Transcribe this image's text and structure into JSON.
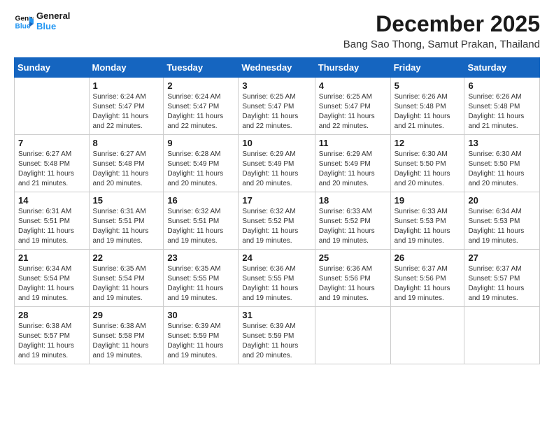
{
  "header": {
    "logo_line1": "General",
    "logo_line2": "Blue",
    "title": "December 2025",
    "subtitle": "Bang Sao Thong, Samut Prakan, Thailand"
  },
  "days_of_week": [
    "Sunday",
    "Monday",
    "Tuesday",
    "Wednesday",
    "Thursday",
    "Friday",
    "Saturday"
  ],
  "weeks": [
    [
      {
        "day": "",
        "info": ""
      },
      {
        "day": "1",
        "info": "Sunrise: 6:24 AM\nSunset: 5:47 PM\nDaylight: 11 hours\nand 22 minutes."
      },
      {
        "day": "2",
        "info": "Sunrise: 6:24 AM\nSunset: 5:47 PM\nDaylight: 11 hours\nand 22 minutes."
      },
      {
        "day": "3",
        "info": "Sunrise: 6:25 AM\nSunset: 5:47 PM\nDaylight: 11 hours\nand 22 minutes."
      },
      {
        "day": "4",
        "info": "Sunrise: 6:25 AM\nSunset: 5:47 PM\nDaylight: 11 hours\nand 22 minutes."
      },
      {
        "day": "5",
        "info": "Sunrise: 6:26 AM\nSunset: 5:48 PM\nDaylight: 11 hours\nand 21 minutes."
      },
      {
        "day": "6",
        "info": "Sunrise: 6:26 AM\nSunset: 5:48 PM\nDaylight: 11 hours\nand 21 minutes."
      }
    ],
    [
      {
        "day": "7",
        "info": "Sunrise: 6:27 AM\nSunset: 5:48 PM\nDaylight: 11 hours\nand 21 minutes."
      },
      {
        "day": "8",
        "info": "Sunrise: 6:27 AM\nSunset: 5:48 PM\nDaylight: 11 hours\nand 20 minutes."
      },
      {
        "day": "9",
        "info": "Sunrise: 6:28 AM\nSunset: 5:49 PM\nDaylight: 11 hours\nand 20 minutes."
      },
      {
        "day": "10",
        "info": "Sunrise: 6:29 AM\nSunset: 5:49 PM\nDaylight: 11 hours\nand 20 minutes."
      },
      {
        "day": "11",
        "info": "Sunrise: 6:29 AM\nSunset: 5:49 PM\nDaylight: 11 hours\nand 20 minutes."
      },
      {
        "day": "12",
        "info": "Sunrise: 6:30 AM\nSunset: 5:50 PM\nDaylight: 11 hours\nand 20 minutes."
      },
      {
        "day": "13",
        "info": "Sunrise: 6:30 AM\nSunset: 5:50 PM\nDaylight: 11 hours\nand 20 minutes."
      }
    ],
    [
      {
        "day": "14",
        "info": "Sunrise: 6:31 AM\nSunset: 5:51 PM\nDaylight: 11 hours\nand 19 minutes."
      },
      {
        "day": "15",
        "info": "Sunrise: 6:31 AM\nSunset: 5:51 PM\nDaylight: 11 hours\nand 19 minutes."
      },
      {
        "day": "16",
        "info": "Sunrise: 6:32 AM\nSunset: 5:51 PM\nDaylight: 11 hours\nand 19 minutes."
      },
      {
        "day": "17",
        "info": "Sunrise: 6:32 AM\nSunset: 5:52 PM\nDaylight: 11 hours\nand 19 minutes."
      },
      {
        "day": "18",
        "info": "Sunrise: 6:33 AM\nSunset: 5:52 PM\nDaylight: 11 hours\nand 19 minutes."
      },
      {
        "day": "19",
        "info": "Sunrise: 6:33 AM\nSunset: 5:53 PM\nDaylight: 11 hours\nand 19 minutes."
      },
      {
        "day": "20",
        "info": "Sunrise: 6:34 AM\nSunset: 5:53 PM\nDaylight: 11 hours\nand 19 minutes."
      }
    ],
    [
      {
        "day": "21",
        "info": "Sunrise: 6:34 AM\nSunset: 5:54 PM\nDaylight: 11 hours\nand 19 minutes."
      },
      {
        "day": "22",
        "info": "Sunrise: 6:35 AM\nSunset: 5:54 PM\nDaylight: 11 hours\nand 19 minutes."
      },
      {
        "day": "23",
        "info": "Sunrise: 6:35 AM\nSunset: 5:55 PM\nDaylight: 11 hours\nand 19 minutes."
      },
      {
        "day": "24",
        "info": "Sunrise: 6:36 AM\nSunset: 5:55 PM\nDaylight: 11 hours\nand 19 minutes."
      },
      {
        "day": "25",
        "info": "Sunrise: 6:36 AM\nSunset: 5:56 PM\nDaylight: 11 hours\nand 19 minutes."
      },
      {
        "day": "26",
        "info": "Sunrise: 6:37 AM\nSunset: 5:56 PM\nDaylight: 11 hours\nand 19 minutes."
      },
      {
        "day": "27",
        "info": "Sunrise: 6:37 AM\nSunset: 5:57 PM\nDaylight: 11 hours\nand 19 minutes."
      }
    ],
    [
      {
        "day": "28",
        "info": "Sunrise: 6:38 AM\nSunset: 5:57 PM\nDaylight: 11 hours\nand 19 minutes."
      },
      {
        "day": "29",
        "info": "Sunrise: 6:38 AM\nSunset: 5:58 PM\nDaylight: 11 hours\nand 19 minutes."
      },
      {
        "day": "30",
        "info": "Sunrise: 6:39 AM\nSunset: 5:59 PM\nDaylight: 11 hours\nand 19 minutes."
      },
      {
        "day": "31",
        "info": "Sunrise: 6:39 AM\nSunset: 5:59 PM\nDaylight: 11 hours\nand 20 minutes."
      },
      {
        "day": "",
        "info": ""
      },
      {
        "day": "",
        "info": ""
      },
      {
        "day": "",
        "info": ""
      }
    ]
  ]
}
